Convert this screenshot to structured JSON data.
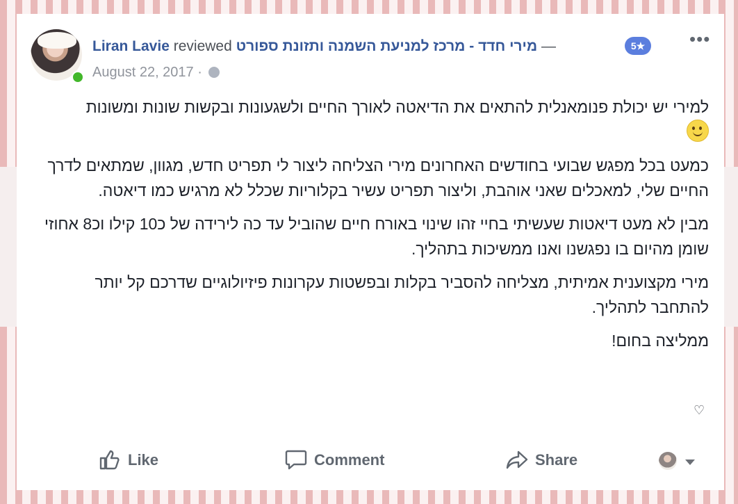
{
  "review": {
    "author": "Liran Lavie",
    "verb": "reviewed",
    "page_name": "מירי חדד - מרכז למניעת השמנה ותזונת ספורט",
    "dash": "—",
    "rating": "5★",
    "date": "August 22, 2017",
    "date_separator": "·",
    "more_label": "•••",
    "audience_icon": "globe-icon"
  },
  "body": {
    "paragraphs": [
      "למירי יש יכולת פנומאנלית להתאים את הדיאטה לאורך החיים ולשגעונות ובקשות שונות ומשונות",
      "כמעט בכל מפגש שבועי בחודשים האחרונים מירי הצליחה ליצור לי תפריט חדש, מגוון, שמתאים לדרך החיים שלי, למאכלים שאני אוהבת, וליצור תפריט עשיר בקלוריות שכלל לא מרגיש כמו דיאטה.",
      "מבין לא מעט דיאטות שעשיתי בחיי זהו שינוי באורח חיים שהוביל עד כה לירידה של כ10 קילו וכ8 אחוזי שומן מהיום בו נפגשנו ואנו ממשיכות בתהליך.",
      "מירי מקצוענית אמיתית, מצליחה להסביר בקלות ובפשטות עקרונות פיזיולוגיים שדרכם קל יותר להתחבר לתהליך.",
      "ממליצה בחום!"
    ],
    "emoji_icon": "smile-emoji-icon",
    "heart": "♡"
  },
  "actions": {
    "like": "Like",
    "comment": "Comment",
    "share": "Share"
  },
  "colors": {
    "name": "#365899",
    "meta": "#90949c",
    "text": "#1d2129",
    "badge": "#5b7ede",
    "action": "#606770",
    "stripe": "#e9b9b9"
  }
}
